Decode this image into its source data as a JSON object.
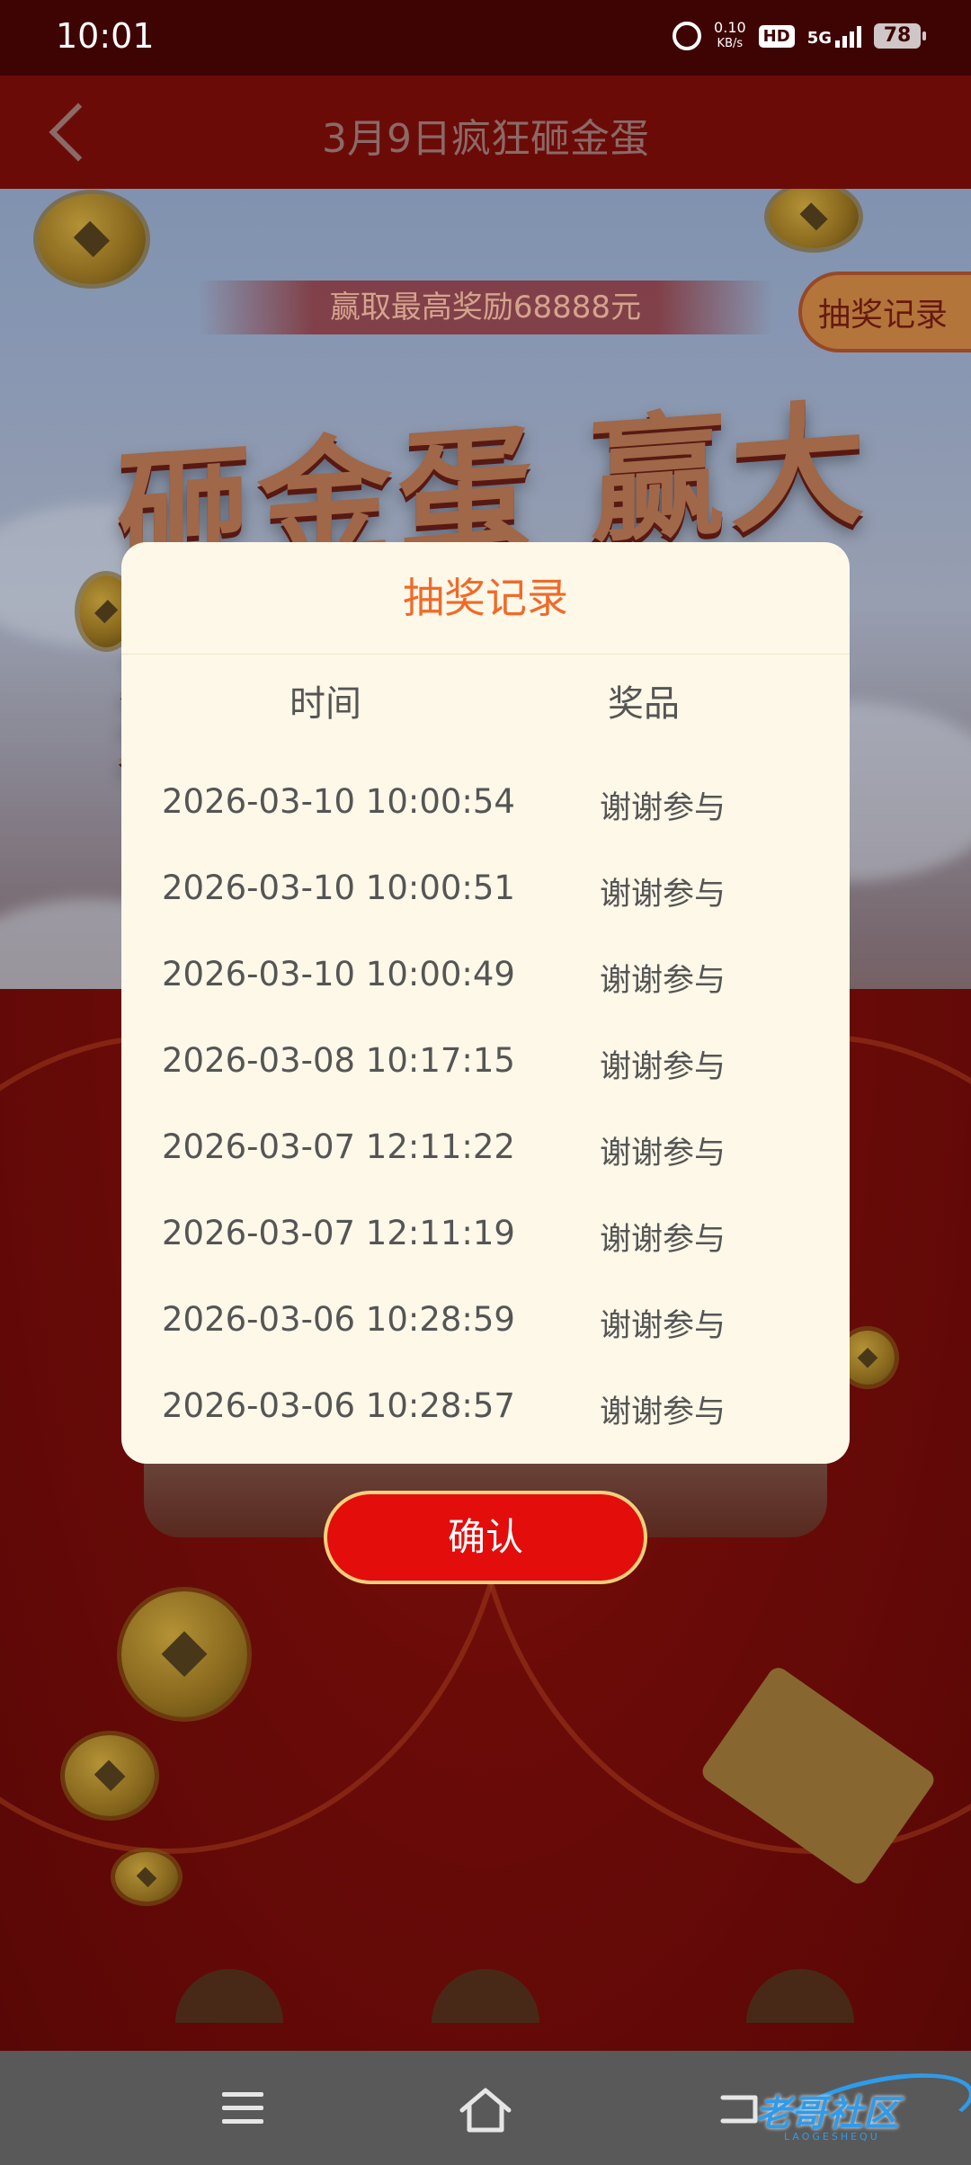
{
  "status_bar": {
    "time": "10:01",
    "net_speed_value": "0.10",
    "net_speed_unit": "KB/s",
    "hd": "HD",
    "network": "5G",
    "battery": "78"
  },
  "header": {
    "title": "3月9日疯狂砸金蛋"
  },
  "background": {
    "reward_banner": "赢取最高奖励68888元",
    "record_button": "抽奖记录",
    "headline": "砸金蛋 赢大奖"
  },
  "modal": {
    "title": "抽奖记录",
    "columns": [
      "时间",
      "奖品"
    ],
    "rows": [
      {
        "time": "2026-03-10 10:00:54",
        "prize": "谢谢参与"
      },
      {
        "time": "2026-03-10 10:00:51",
        "prize": "谢谢参与"
      },
      {
        "time": "2026-03-10 10:00:49",
        "prize": "谢谢参与"
      },
      {
        "time": "2026-03-08 10:17:15",
        "prize": "谢谢参与"
      },
      {
        "time": "2026-03-07 12:11:22",
        "prize": "谢谢参与"
      },
      {
        "time": "2026-03-07 12:11:19",
        "prize": "谢谢参与"
      },
      {
        "time": "2026-03-06 10:28:59",
        "prize": "谢谢参与"
      },
      {
        "time": "2026-03-06 10:28:57",
        "prize": "谢谢参与"
      }
    ],
    "confirm_label": "确认"
  },
  "watermark": {
    "text": "老哥社区",
    "subtext": "LAOGESHEQU"
  },
  "colors": {
    "accent_title": "#f06a2a",
    "confirm_bg": "#e30d0c",
    "confirm_border": "#f6cf7a",
    "modal_bg": "#fdf8e8"
  },
  "icons": {
    "back": "chevron-left-icon",
    "alarm": "alarm-icon",
    "menu": "menu-icon",
    "home": "home-icon",
    "sys_back": "back-icon"
  }
}
